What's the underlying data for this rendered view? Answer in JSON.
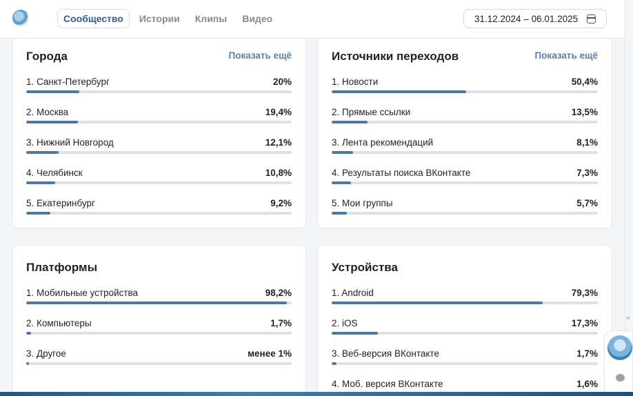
{
  "header": {
    "tabs": [
      "Сообщество",
      "Истории",
      "Клипы",
      "Видео"
    ],
    "active_tab": "Сообщество",
    "date_range": "31.12.2024 – 06.01.2025"
  },
  "icons": {
    "calendar": "calendar-icon",
    "chat": "chat-icon",
    "collapse": "double-chevron-left-icon"
  },
  "colors": {
    "bar": "#4a76a8",
    "track": "#dce1e6",
    "link": "#5b7fa6",
    "active_tab": "#2d5f97"
  },
  "cities": {
    "title": "Города",
    "more": "Показать ещё",
    "rows": [
      {
        "label": "1. Санкт-Петербург",
        "value": "20%",
        "fraction": 0.2
      },
      {
        "label": "2. Москва",
        "value": "19,4%",
        "fraction": 0.194
      },
      {
        "label": "3. Нижний Новгород",
        "value": "12,1%",
        "fraction": 0.121
      },
      {
        "label": "4. Челябинск",
        "value": "10,8%",
        "fraction": 0.108
      },
      {
        "label": "5. Екатеринбург",
        "value": "9,2%",
        "fraction": 0.092
      }
    ]
  },
  "sources": {
    "title": "Источники переходов",
    "more": "Показать ещё",
    "rows": [
      {
        "label": "1. Новости",
        "value": "50,4%",
        "fraction": 0.504
      },
      {
        "label": "2. Прямые ссылки",
        "value": "13,5%",
        "fraction": 0.135
      },
      {
        "label": "3. Лента рекомендаций",
        "value": "8,1%",
        "fraction": 0.081
      },
      {
        "label": "4. Результаты поиска ВКонтакте",
        "value": "7,3%",
        "fraction": 0.073
      },
      {
        "label": "5. Мои группы",
        "value": "5,7%",
        "fraction": 0.057
      }
    ]
  },
  "platforms": {
    "title": "Платформы",
    "rows": [
      {
        "label": "1. Мобильные устройства",
        "value": "98,2%",
        "fraction": 0.982
      },
      {
        "label": "2. Компьютеры",
        "value": "1,7%",
        "fraction": 0.017
      },
      {
        "label": "3. Другое",
        "value": "менее 1%",
        "fraction": 0.01
      }
    ]
  },
  "devices": {
    "title": "Устройства",
    "rows": [
      {
        "label": "1. Android",
        "value": "79,3%",
        "fraction": 0.793
      },
      {
        "label": "2. iOS",
        "value": "17,3%",
        "fraction": 0.173
      },
      {
        "label": "3. Веб-версия ВКонтакте",
        "value": "1,7%",
        "fraction": 0.017
      },
      {
        "label": "4. Моб. версия ВКонтакте",
        "value": "1,6%",
        "fraction": 0.016
      }
    ]
  }
}
